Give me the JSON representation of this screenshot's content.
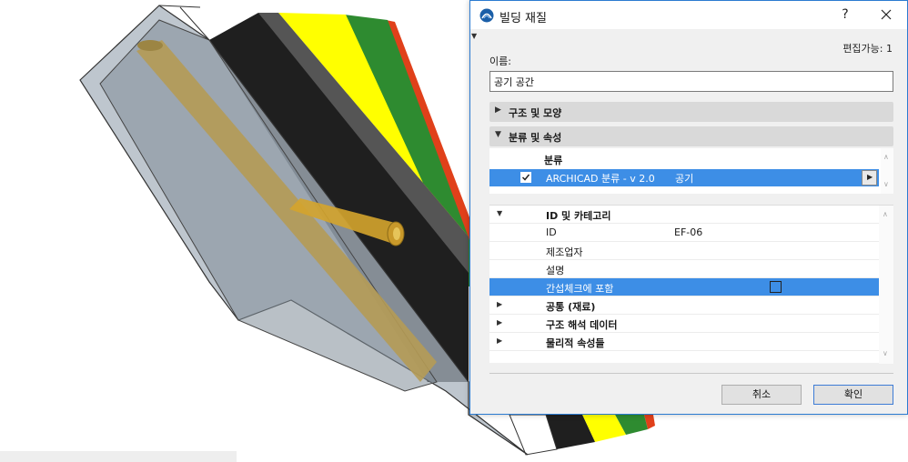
{
  "dialog": {
    "title": "빌딩 재질",
    "help_label": "?",
    "editable_text": "편집가능: 1",
    "name_label": "이름:",
    "name_value": "공기 공간",
    "sections": {
      "structure": "구조 및 모양",
      "classification": "분류 및 속성"
    },
    "classification": {
      "header": "분류",
      "row_name": "ARCHICAD 분류 - v 2.0",
      "row_value": "공기",
      "checked": true
    },
    "properties": {
      "group_id": "ID 및 카테고리",
      "rows": [
        {
          "key": "ID",
          "value": "EF-06"
        },
        {
          "key": "제조업자",
          "value": ""
        },
        {
          "key": "설명",
          "value": ""
        }
      ],
      "selected_row": {
        "key": "간섭체크에 포함",
        "checked": false
      },
      "groups": [
        "공통 (재료)",
        "구조 해석 데이터",
        "물리적 속성들"
      ]
    },
    "buttons": {
      "cancel": "취소",
      "ok": "확인"
    }
  },
  "colors": {
    "accent": "#3d8ee6",
    "border": "#2b7bd1",
    "layer_black": "#1f1f1f",
    "layer_yellow": "#ffff00",
    "layer_green": "#2e8b30",
    "layer_red": "#e0401a",
    "glass": "#b8c2cc",
    "pipe": "#b59b55"
  },
  "icons": {
    "app": "archicad-logo-icon",
    "close": "close-icon",
    "expand": "triangle-right-icon",
    "collapse": "triangle-down-icon"
  }
}
